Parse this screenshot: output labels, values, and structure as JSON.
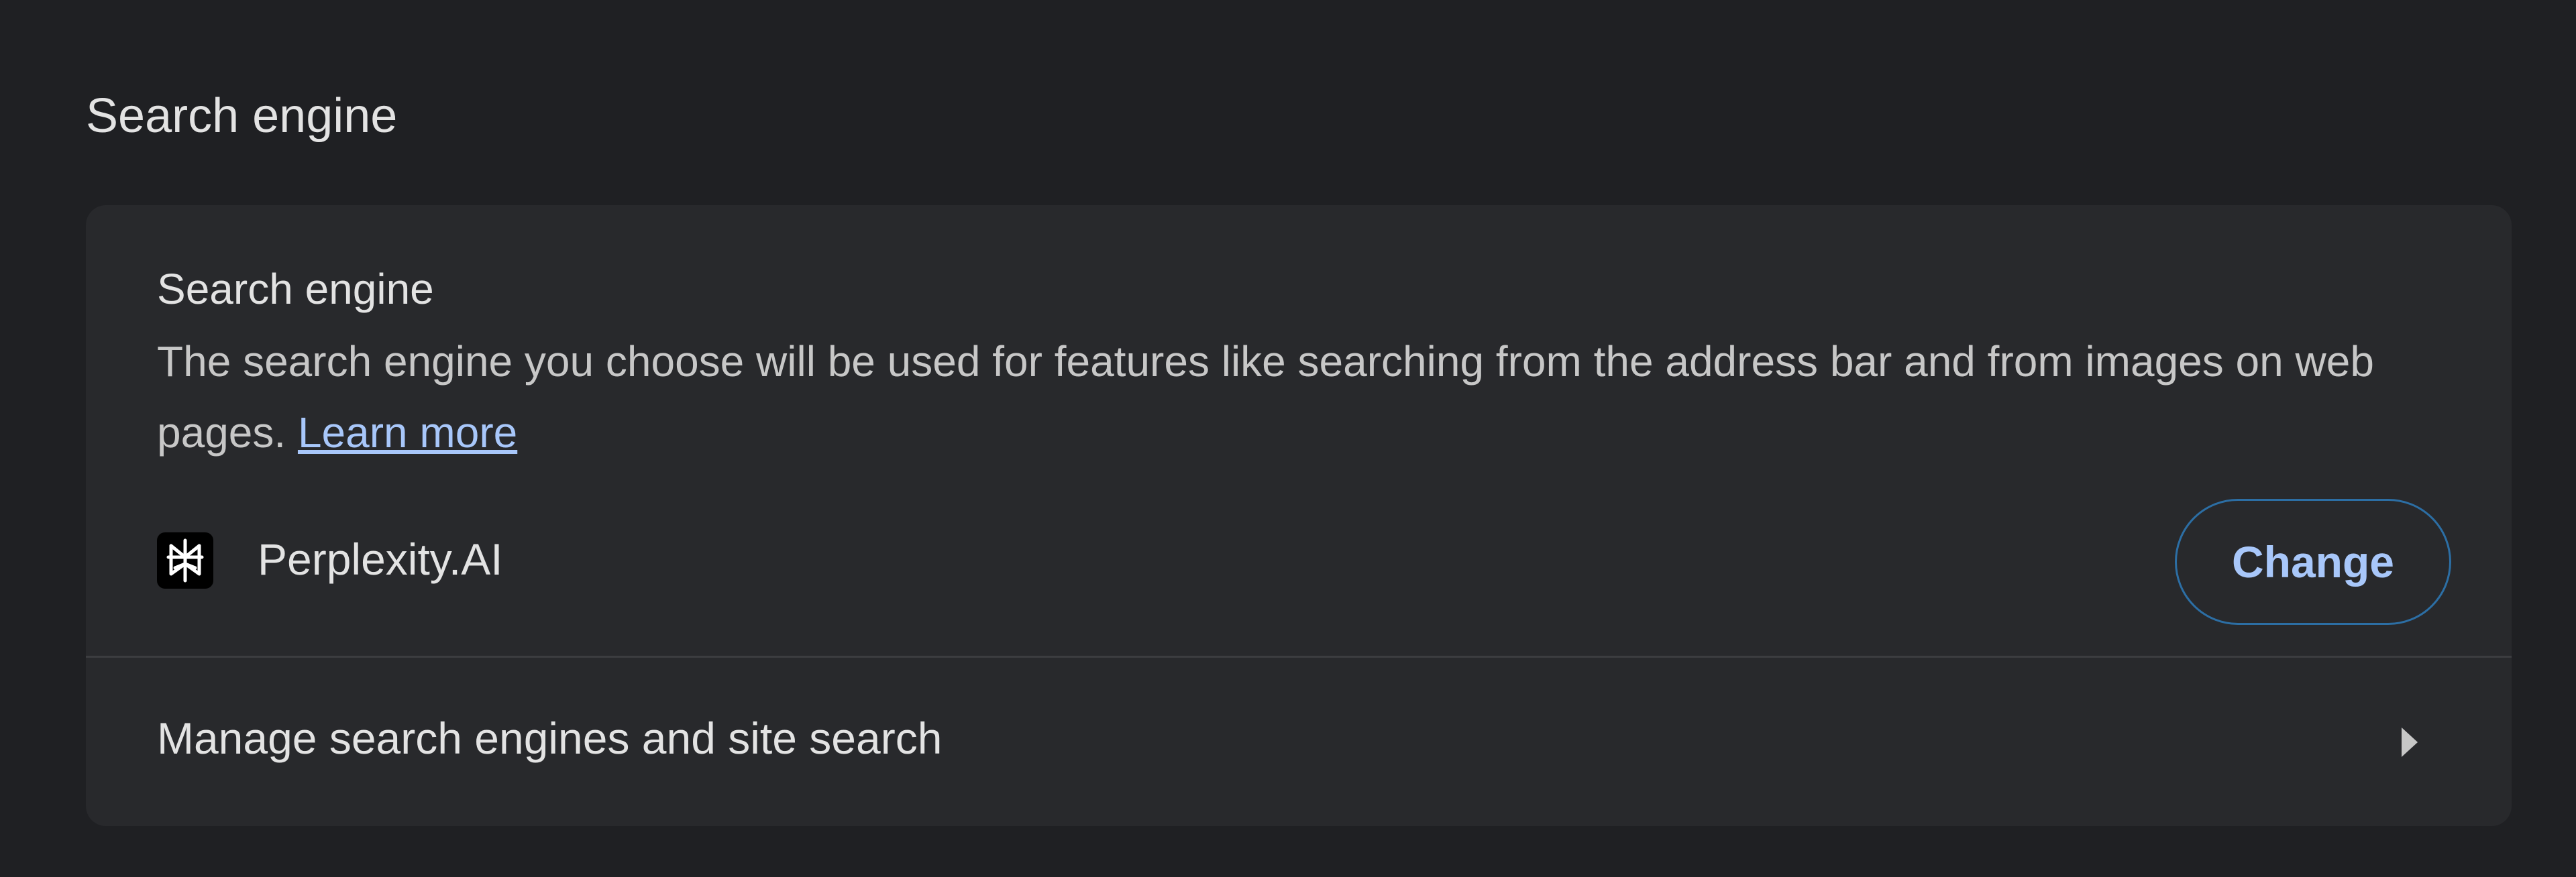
{
  "section": {
    "title": "Search engine"
  },
  "card": {
    "title": "Search engine",
    "description": "The search engine you choose will be used for features like searching from the address bar and from images on web pages.",
    "learn_more": "Learn more"
  },
  "current_engine": {
    "name": "Perplexity.AI",
    "icon": "perplexity-logo-icon",
    "change_label": "Change"
  },
  "manage": {
    "label": "Manage search engines and site search",
    "icon": "chevron-right-icon"
  },
  "colors": {
    "background": "#1f2023",
    "card": "#28292c",
    "link": "#a8c7fa",
    "button_border": "#2c6ea4"
  }
}
